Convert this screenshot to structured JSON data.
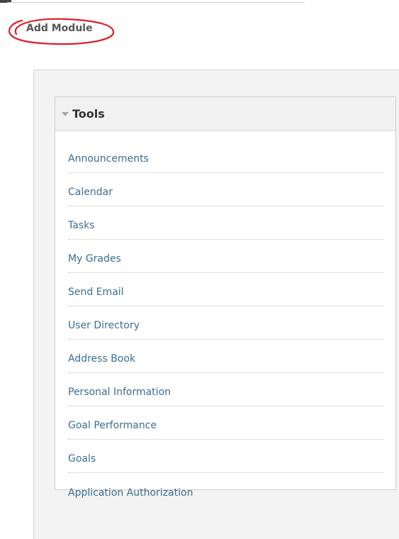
{
  "annotation": {
    "color": "#d91f2a"
  },
  "header": {
    "add_module_label": "Add Module"
  },
  "tools_module": {
    "title": "Tools",
    "collapse_icon": "triangle-down-icon",
    "link_color": "#3a6e93",
    "items": [
      {
        "label": "Announcements"
      },
      {
        "label": "Calendar"
      },
      {
        "label": "Tasks"
      },
      {
        "label": "My Grades"
      },
      {
        "label": "Send Email"
      },
      {
        "label": "User Directory"
      },
      {
        "label": "Address Book"
      },
      {
        "label": "Personal Information"
      },
      {
        "label": "Goal Performance"
      },
      {
        "label": "Goals"
      },
      {
        "label": "Application Authorization"
      }
    ]
  }
}
